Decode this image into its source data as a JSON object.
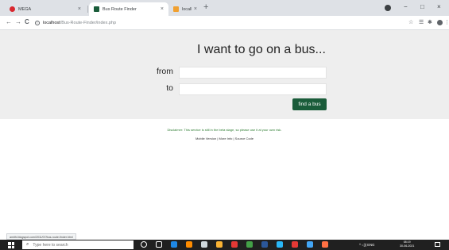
{
  "tabs": [
    {
      "title": "MEGA",
      "icon": "mega-icon",
      "color": "#d9272e",
      "close": "×"
    },
    {
      "title": "Bus Route Finder",
      "icon": "page-icon",
      "color": "#1a5c3a",
      "close": "×"
    },
    {
      "title": "localhost / 127.0.0.1 / testbus / e",
      "icon": "phpmyadmin-icon",
      "color": "#f0a030",
      "close": "×"
    }
  ],
  "new_tab": "+",
  "window_controls": {
    "minimize": "−",
    "maximize": "□",
    "close": "×"
  },
  "toolbar": {
    "back": "←",
    "forward": "→",
    "reload": "C",
    "info": "i",
    "url_host": "localhost",
    "url_path": "/Bus-Route-Finder/index.php",
    "star": "☆",
    "ext": "☰",
    "puzzle": "✱",
    "menu": "⋮"
  },
  "page": {
    "heading": "I want to go on a bus...",
    "from_label": "from",
    "to_label": "to",
    "from_value": "",
    "to_value": "",
    "submit_label": "find a bus",
    "disclaimer": "Disclaimer: This service is still in the beta stage, so please use it at your own risk.",
    "links": [
      "Mobile Version",
      "More Info",
      "Source Code"
    ],
    "link_sep": " | "
  },
  "statusbar_text": "amithi.blogspot.com/2011/07/bus-route-finder.html",
  "taskbar": {
    "search_placeholder": "Type here to search",
    "search_glass": "⌕",
    "apps": [
      {
        "name": "cortana-icon",
        "color": "#ffffff"
      },
      {
        "name": "taskview-icon",
        "color": "#ffffff"
      },
      {
        "name": "edge-icon",
        "color": "#1e88e5"
      },
      {
        "name": "vlc-icon",
        "color": "#ff8c00"
      },
      {
        "name": "store-icon",
        "color": "#cfd8dc"
      },
      {
        "name": "explorer-icon",
        "color": "#f9b233"
      },
      {
        "name": "app-red-icon",
        "color": "#e53935"
      },
      {
        "name": "chrome-icon",
        "color": "#43a047"
      },
      {
        "name": "word-icon",
        "color": "#2b579a"
      },
      {
        "name": "app-car-icon",
        "color": "#29b6f6"
      },
      {
        "name": "app-red2-icon",
        "color": "#e53935"
      },
      {
        "name": "app-blue-icon",
        "color": "#42a5f5"
      },
      {
        "name": "app-orange-icon",
        "color": "#ff7043"
      }
    ],
    "tray": "^  ◁)) ENG",
    "time": "08:19",
    "date": "30-06-2021"
  }
}
